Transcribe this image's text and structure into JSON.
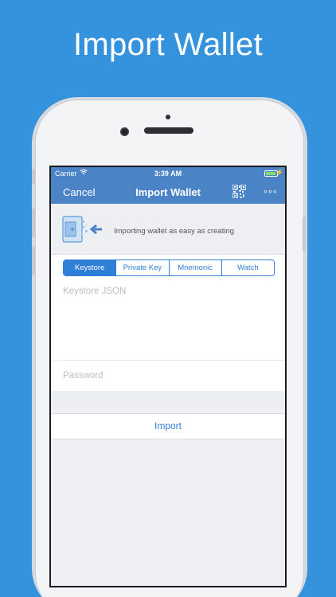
{
  "promo": {
    "title": "Import Wallet"
  },
  "status_bar": {
    "carrier": "Carrier",
    "time": "3:39 AM"
  },
  "nav": {
    "cancel_label": "Cancel",
    "title": "Import Wallet",
    "qr_icon": "qr-code-icon",
    "more_icon": "more-icon",
    "more_glyph": "∘∘∘"
  },
  "banner": {
    "text": "Importing wallet as easy as creating",
    "icon": "wallet-import-icon"
  },
  "tabs": [
    {
      "label": "Keystore",
      "active": true
    },
    {
      "label": "Private Key",
      "active": false
    },
    {
      "label": "Mnemonic",
      "active": false
    },
    {
      "label": "Watch",
      "active": false
    }
  ],
  "form": {
    "keystore_placeholder": "Keystore JSON",
    "keystore_value": "",
    "password_placeholder": "Password",
    "password_value": "",
    "import_label": "Import"
  },
  "colors": {
    "background": "#3592dd",
    "nav_bar": "#4a84c6",
    "accent": "#2f7fd9",
    "battery": "#7ee06a"
  }
}
